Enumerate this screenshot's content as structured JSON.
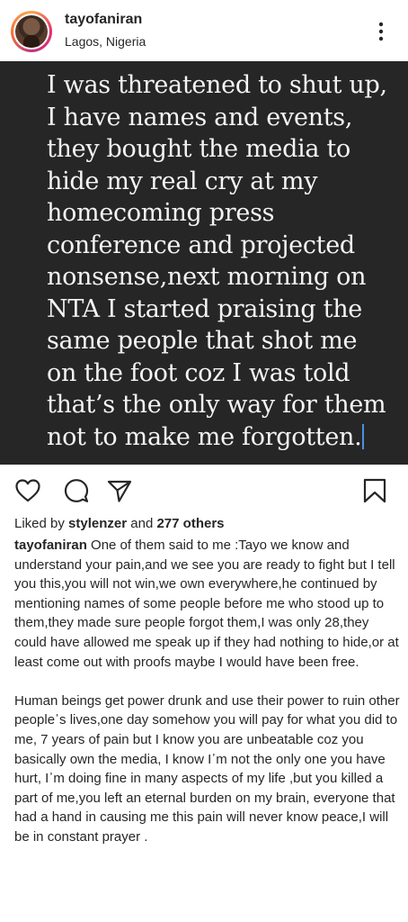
{
  "header": {
    "username": "tayofaniran",
    "location": "Lagos, Nigeria",
    "avatar_icon": "profile-avatar",
    "more_icon": "vertical-ellipsis-icon"
  },
  "post": {
    "quote_text": "I was threatened to shut up,\nI have names and events,\nthey bought the media to\nhide my real cry at my\nhomecoming press\nconference and projected\nnonsense,next morning on\nNTA I started praising the\nsame people that shot me\non the foot coz I was told\nthat’s the only way for them\nnot to make me forgotten.",
    "background_color": "#262626",
    "text_color": "#f4f4f4"
  },
  "actions": {
    "like_icon": "heart-icon",
    "comment_icon": "comment-icon",
    "share_icon": "paper-plane-icon",
    "save_icon": "bookmark-icon"
  },
  "likes": {
    "prefix": "Liked by ",
    "user": "stylenzer",
    "middle": " and ",
    "count": "277 others"
  },
  "caption": {
    "username": "tayofaniran",
    "text": " One of them said to me :Tayo we know and understand your pain,and we see you are ready to fight but I tell you this,you will not win,we own everywhere,he continued by mentioning names of some people before me who stood up to them,they made sure people forgot them,I was only 28,they could have allowed me speak up if they had nothing to hide,or at least come out with proofs maybe I would have been free.\n\nHuman beings get power drunk and use their power to ruin other people᾽s lives,one day somehow you will pay for what you did to me, 7 years of pain but I know you are unbeatable coz you basically own the media, I know I᾽m not the only one you have hurt, I᾽m doing fine in many aspects of my life ,but you killed a part of me,you left an eternal burden on my brain, everyone that had a hand in causing me this pain will never know peace,I will be in constant prayer ."
  }
}
